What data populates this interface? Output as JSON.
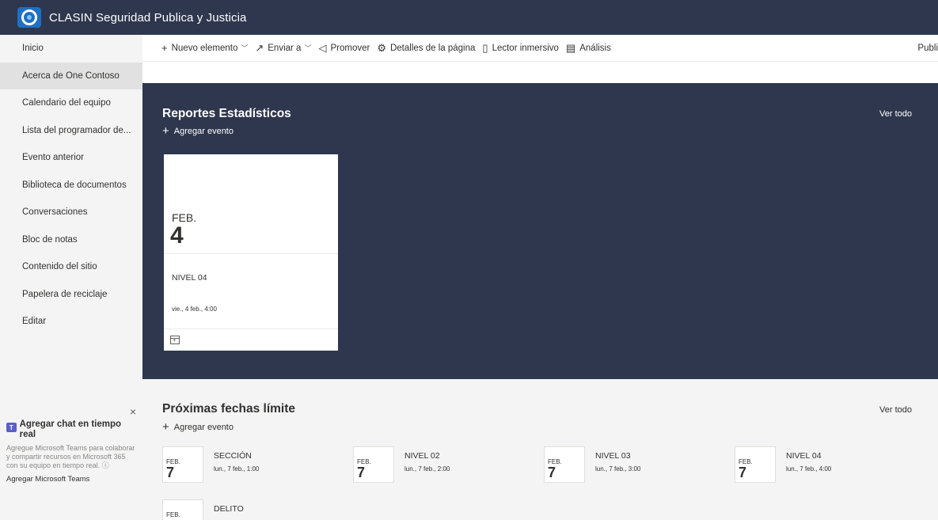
{
  "suite": {
    "title": "CLASIN Seguridad Publica y Justicia",
    "logo_icon": "globe-eye-icon"
  },
  "nav": {
    "items": [
      {
        "label": "Inicio",
        "selected": false
      },
      {
        "label": "Acerca de One Contoso",
        "selected": true
      },
      {
        "label": "Calendario del equipo",
        "selected": false
      },
      {
        "label": "Lista del programador de...",
        "selected": false
      },
      {
        "label": "Evento anterior",
        "selected": false
      },
      {
        "label": "Biblioteca de documentos",
        "selected": false
      },
      {
        "label": "Conversaciones",
        "selected": false
      },
      {
        "label": "Bloc de notas",
        "selected": false
      },
      {
        "label": "Contenido del sitio",
        "selected": false
      },
      {
        "label": "Papelera de reciclaje",
        "selected": false
      },
      {
        "label": "Editar",
        "selected": false
      }
    ]
  },
  "teams_promo": {
    "title": "Agregar chat en tiempo real",
    "description": "Agregue Microsoft Teams para colaborar y compartir recursos en Microsoft 365 con su equipo en tiempo real.",
    "info_icon": "ⓘ",
    "link": "Agregar Microsoft Teams",
    "close_icon": "×"
  },
  "commandbar": {
    "new_item": "Nuevo elemento",
    "send_to": "Enviar a",
    "promote": "Promover",
    "page_details": "Detalles de la página",
    "immersive_reader": "Lector inmersivo",
    "analytics": "Análisis",
    "publish": "Publi"
  },
  "reports": {
    "title": "Reportes Estadísticos",
    "add_event": "Agregar evento",
    "see_all": "Ver todo",
    "event": {
      "month": "FEB.",
      "day": "4",
      "title": "NIVEL 04",
      "time": "vie., 4 feb., 4:00"
    }
  },
  "deadlines": {
    "title": "Próximas fechas límite",
    "add_event": "Agregar evento",
    "see_all": "Ver todo",
    "items": [
      {
        "month": "FEB.",
        "day": "7",
        "title": "SECCIÓN",
        "time": "lun., 7 feb., 1:00"
      },
      {
        "month": "FEB.",
        "day": "7",
        "title": "NIVEL 02",
        "time": "lun., 7 feb., 2:00"
      },
      {
        "month": "FEB.",
        "day": "7",
        "title": "NIVEL 03",
        "time": "lun., 7 feb., 3:00"
      },
      {
        "month": "FEB.",
        "day": "7",
        "title": "NIVEL 04",
        "time": "lun., 7 feb., 4:00"
      },
      {
        "month": "FEB.",
        "day": "",
        "title": "DELITO",
        "time": ""
      }
    ]
  },
  "colors": {
    "suite_bg": "#2e374e",
    "nav_bg": "#f4f4f4",
    "dark_section": "#2e374e",
    "light_section": "#f4f4f4"
  }
}
